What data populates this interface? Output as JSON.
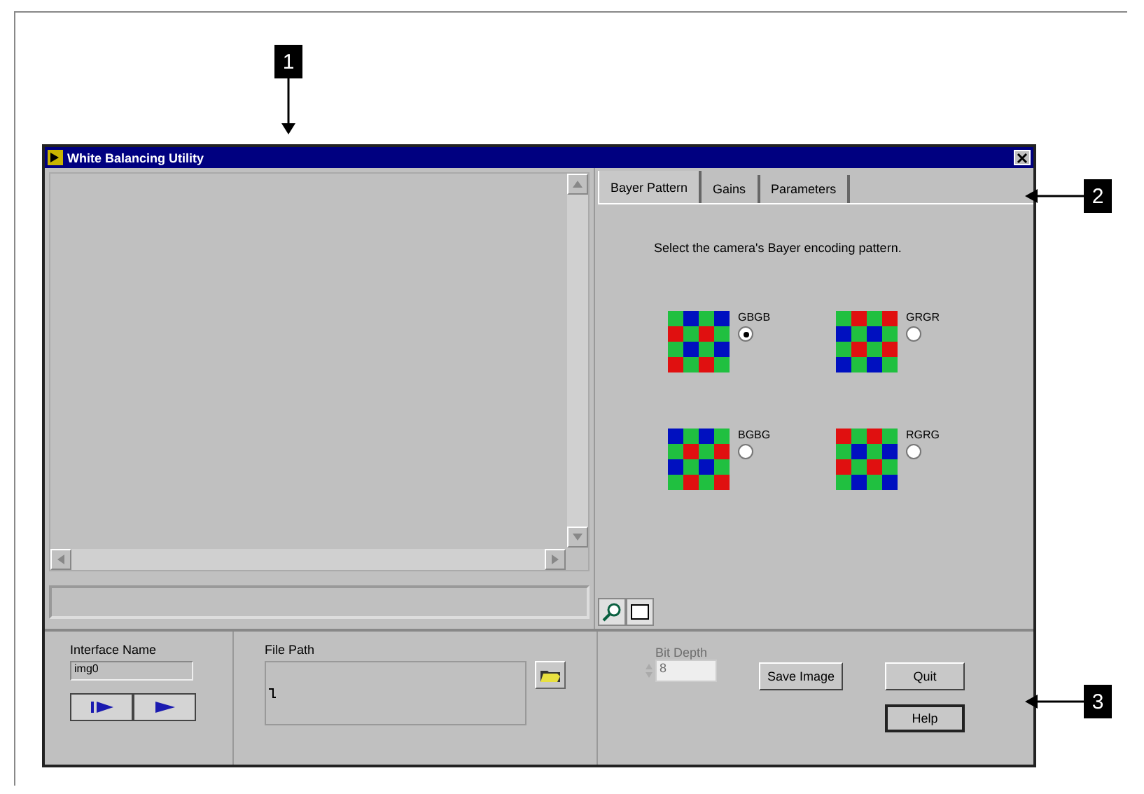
{
  "callouts": [
    {
      "label": "1",
      "kind": "down"
    },
    {
      "label": "2",
      "kind": "left"
    },
    {
      "label": "3",
      "kind": "left"
    }
  ],
  "window": {
    "title": "White Balancing Utility"
  },
  "tabs": [
    {
      "label": "Bayer Pattern",
      "selected": true
    },
    {
      "label": "Gains",
      "selected": false
    },
    {
      "label": "Parameters",
      "selected": false
    }
  ],
  "instruction": "Select the camera's Bayer encoding pattern.",
  "patterns": [
    {
      "label": "GBGB",
      "selected": true,
      "cells": [
        {
          "color": "#20c040"
        },
        {
          "color": "#0010c0"
        },
        {
          "color": "#20c040"
        },
        {
          "color": "#0010c0"
        },
        {
          "color": "#e01010"
        },
        {
          "color": "#20c040"
        },
        {
          "color": "#e01010"
        },
        {
          "color": "#20c040"
        },
        {
          "color": "#20c040"
        },
        {
          "color": "#0010c0"
        },
        {
          "color": "#20c040"
        },
        {
          "color": "#0010c0"
        },
        {
          "color": "#e01010"
        },
        {
          "color": "#20c040"
        },
        {
          "color": "#e01010"
        },
        {
          "color": "#20c040"
        }
      ]
    },
    {
      "label": "GRGR",
      "selected": false,
      "cells": [
        {
          "color": "#20c040"
        },
        {
          "color": "#e01010"
        },
        {
          "color": "#20c040"
        },
        {
          "color": "#e01010"
        },
        {
          "color": "#0010c0"
        },
        {
          "color": "#20c040"
        },
        {
          "color": "#0010c0"
        },
        {
          "color": "#20c040"
        },
        {
          "color": "#20c040"
        },
        {
          "color": "#e01010"
        },
        {
          "color": "#20c040"
        },
        {
          "color": "#e01010"
        },
        {
          "color": "#0010c0"
        },
        {
          "color": "#20c040"
        },
        {
          "color": "#0010c0"
        },
        {
          "color": "#20c040"
        }
      ]
    },
    {
      "label": "BGBG",
      "selected": false,
      "cells": [
        {
          "color": "#0010c0"
        },
        {
          "color": "#20c040"
        },
        {
          "color": "#0010c0"
        },
        {
          "color": "#20c040"
        },
        {
          "color": "#20c040"
        },
        {
          "color": "#e01010"
        },
        {
          "color": "#20c040"
        },
        {
          "color": "#e01010"
        },
        {
          "color": "#0010c0"
        },
        {
          "color": "#20c040"
        },
        {
          "color": "#0010c0"
        },
        {
          "color": "#20c040"
        },
        {
          "color": "#20c040"
        },
        {
          "color": "#e01010"
        },
        {
          "color": "#20c040"
        },
        {
          "color": "#e01010"
        }
      ]
    },
    {
      "label": "RGRG",
      "selected": false,
      "cells": [
        {
          "color": "#e01010"
        },
        {
          "color": "#20c040"
        },
        {
          "color": "#e01010"
        },
        {
          "color": "#20c040"
        },
        {
          "color": "#20c040"
        },
        {
          "color": "#0010c0"
        },
        {
          "color": "#20c040"
        },
        {
          "color": "#0010c0"
        },
        {
          "color": "#e01010"
        },
        {
          "color": "#20c040"
        },
        {
          "color": "#e01010"
        },
        {
          "color": "#20c040"
        },
        {
          "color": "#20c040"
        },
        {
          "color": "#0010c0"
        },
        {
          "color": "#20c040"
        },
        {
          "color": "#0010c0"
        }
      ]
    }
  ],
  "interface": {
    "label": "Interface Name",
    "value": "img0"
  },
  "file_path": {
    "label": "File Path"
  },
  "bit_depth": {
    "label": "Bit Depth",
    "value": "8",
    "disabled": true
  },
  "buttons": [
    "Save Image",
    "Quit",
    "Help"
  ]
}
